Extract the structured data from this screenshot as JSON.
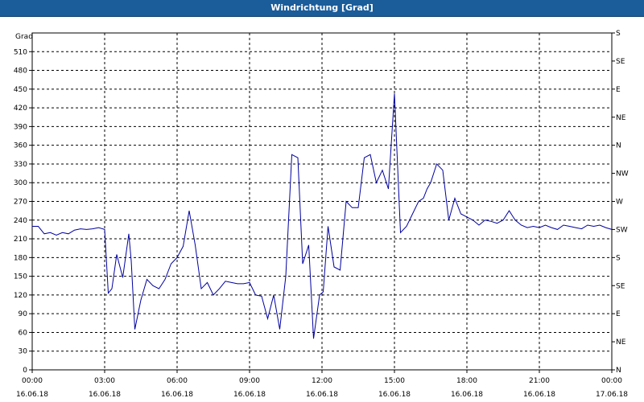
{
  "window": {
    "title": "Windrichtung [Grad]"
  },
  "colors": {
    "titlebar": "#1b5c9a",
    "line": "#0000a0",
    "grid": "#000000"
  },
  "chart_data": {
    "type": "line",
    "title": "Windrichtung [Grad]",
    "ylabel": "Grad",
    "ylim": [
      0,
      540
    ],
    "grid": true,
    "y_ticks": [
      "0",
      "30",
      "60",
      "90",
      "120",
      "150",
      "180",
      "210",
      "240",
      "270",
      "300",
      "330",
      "360",
      "390",
      "420",
      "450",
      "480",
      "510"
    ],
    "right_axis_labels": [
      "N",
      "NE",
      "E",
      "SE",
      "S",
      "SW",
      "W",
      "NW",
      "N",
      "NE",
      "E",
      "SE",
      "S"
    ],
    "x_ticks": [
      {
        "time": "00:00",
        "date": "16.06.18"
      },
      {
        "time": "03:00",
        "date": "16.06.18"
      },
      {
        "time": "06:00",
        "date": "16.06.18"
      },
      {
        "time": "09:00",
        "date": "16.06.18"
      },
      {
        "time": "12:00",
        "date": "16.06.18"
      },
      {
        "time": "15:00",
        "date": "16.06.18"
      },
      {
        "time": "18:00",
        "date": "16.06.18"
      },
      {
        "time": "21:00",
        "date": "16.06.18"
      },
      {
        "time": "00:00",
        "date": "17.06.18"
      }
    ],
    "series": [
      {
        "x_hours": [
          0,
          0.25,
          0.5,
          0.75,
          1,
          1.25,
          1.5,
          1.75,
          2,
          2.25,
          2.5,
          2.75,
          3,
          3.15,
          3.3,
          3.5,
          3.75,
          4,
          4.1,
          4.25,
          4.5,
          4.75,
          5,
          5.25,
          5.5,
          5.75,
          6,
          6.25,
          6.5,
          6.75,
          7,
          7.25,
          7.5,
          7.75,
          8,
          8.25,
          8.5,
          8.75,
          9,
          9.25,
          9.5,
          9.75,
          10,
          10.25,
          10.5,
          10.75,
          11,
          11.2,
          11.45,
          11.65,
          11.9,
          12.05,
          12.25,
          12.5,
          12.75,
          13,
          13.25,
          13.5,
          13.75,
          14,
          14.25,
          14.5,
          14.75,
          15,
          15.25,
          15.5,
          15.75,
          16,
          16.2,
          16.35,
          16.5,
          16.75,
          17,
          17.25,
          17.5,
          17.75,
          18,
          18.25,
          18.5,
          18.75,
          19,
          19.25,
          19.5,
          19.75,
          20,
          20.25,
          20.5,
          20.75,
          21,
          21.25,
          21.5,
          21.75,
          22,
          22.25,
          22.5,
          22.75,
          23,
          23.25,
          23.5,
          23.75,
          24
        ],
        "values": [
          230,
          230,
          218,
          220,
          216,
          220,
          218,
          224,
          226,
          225,
          226,
          228,
          225,
          123,
          130,
          185,
          148,
          218,
          175,
          65,
          112,
          145,
          135,
          130,
          145,
          170,
          180,
          198,
          255,
          200,
          130,
          140,
          120,
          130,
          142,
          140,
          138,
          138,
          140,
          120,
          118,
          82,
          120,
          65,
          150,
          345,
          340,
          170,
          200,
          50,
          120,
          125,
          230,
          165,
          160,
          270,
          260,
          260,
          340,
          345,
          300,
          320,
          290,
          443,
          220,
          230,
          250,
          270,
          275,
          290,
          300,
          330,
          320,
          240,
          275,
          250,
          245,
          240,
          232,
          240,
          238,
          235,
          240,
          255,
          240,
          232,
          228,
          230,
          228,
          232,
          228,
          225,
          232,
          230,
          228,
          226,
          232,
          230,
          232,
          228,
          225,
          230,
          226
        ]
      }
    ]
  }
}
